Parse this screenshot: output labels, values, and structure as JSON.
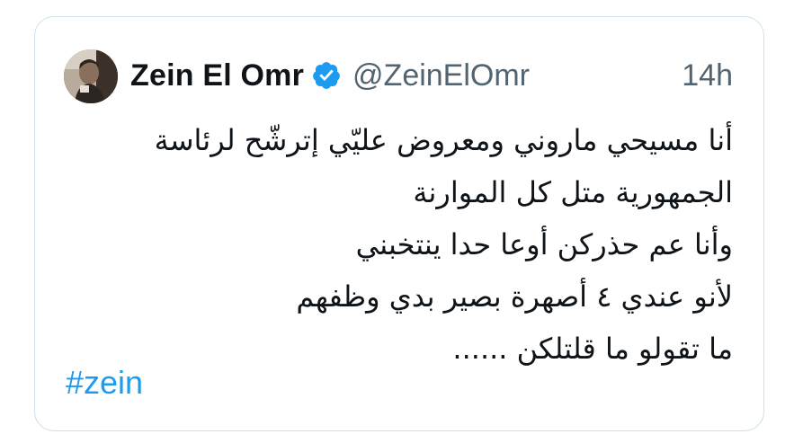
{
  "tweet": {
    "author": {
      "display_name": "Zein El Omr",
      "handle": "@ZeinElOmr",
      "verified": true,
      "avatar_icon": "profile-photo"
    },
    "timestamp": "14h",
    "text_lines": [
      "أنا مسيحي ماروني ومعروض عليّي إترشّح لرئاسة",
      "الجمهورية متل كل الموارنة",
      "وأنا عم حذركن أوعا حدا ينتخبني",
      "لأنو عندي ٤ أصهرة بصير بدي وظفهم",
      "ما تقولو ما قلتلكن ......"
    ],
    "hashtag": "#zein"
  },
  "colors": {
    "border": "#cfe0ea",
    "text": "#0f1419",
    "secondary": "#536471",
    "link": "#1d9bf0",
    "verified_badge": "#1d9bf0"
  }
}
